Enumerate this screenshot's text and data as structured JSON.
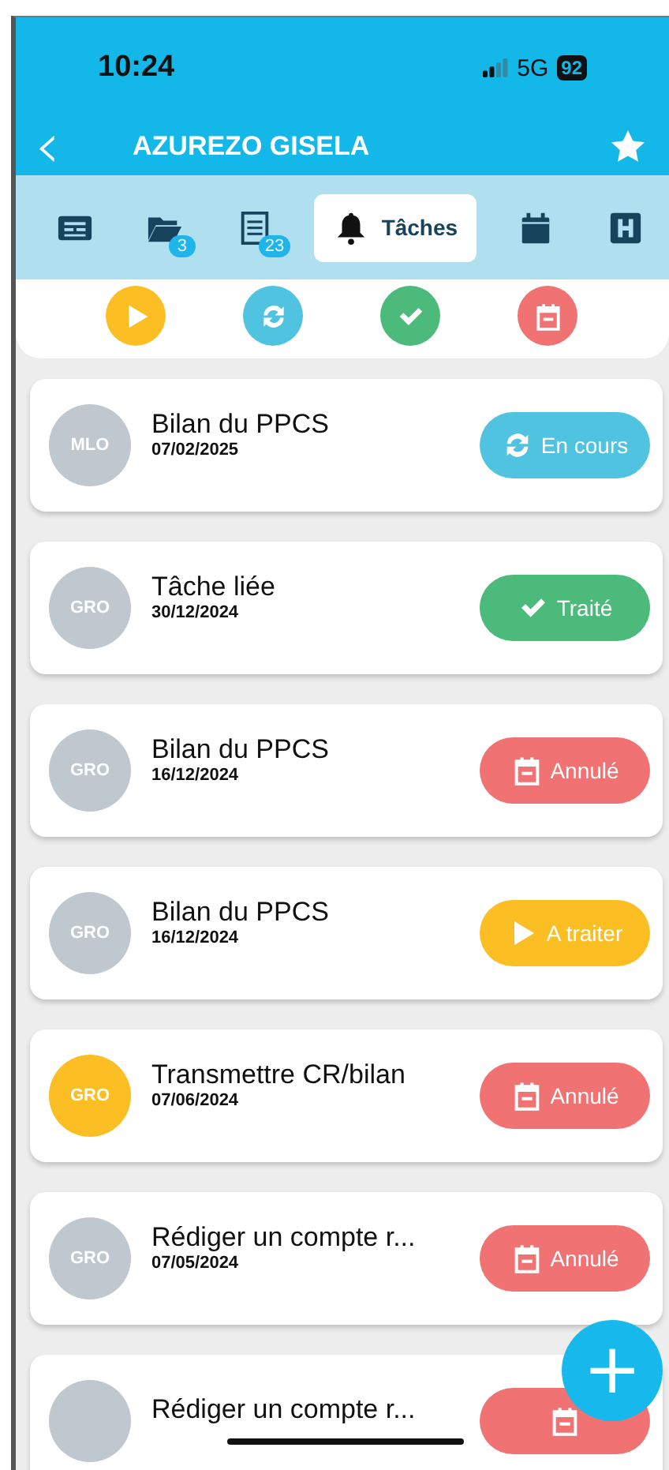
{
  "status_bar": {
    "time": "10:24",
    "network": "5G",
    "battery": "92"
  },
  "header": {
    "back": "‹",
    "title": "AZUREZO GISELA"
  },
  "tabs": [
    {
      "kind": "list",
      "selected": false
    },
    {
      "kind": "folder",
      "count": "3",
      "selected": false
    },
    {
      "kind": "document",
      "count": "23",
      "selected": false
    },
    {
      "kind": "bell",
      "label": "Tâches",
      "selected": true
    },
    {
      "kind": "calendar",
      "selected": false
    },
    {
      "kind": "hospital",
      "selected": false
    }
  ],
  "filters": [
    {
      "kind": "atraiter"
    },
    {
      "kind": "encours"
    },
    {
      "kind": "traite"
    },
    {
      "kind": "annule"
    }
  ],
  "tasks": [
    {
      "initials": "MLO",
      "color": "#bfc7cf",
      "title": "Bilan du PPCS",
      "date": "07/02/2025",
      "status": {
        "kind": "encours",
        "label": "En cours"
      }
    },
    {
      "initials": "GRO",
      "color": "#bfc7cf",
      "title": "Tâche liée",
      "date": "30/12/2024",
      "status": {
        "kind": "traite",
        "label": "Traité"
      }
    },
    {
      "initials": "GRO",
      "color": "#bfc7cf",
      "title": "Bilan du PPCS",
      "date": "16/12/2024",
      "status": {
        "kind": "annule",
        "label": "Annulé"
      }
    },
    {
      "initials": "GRO",
      "color": "#bfc7cf",
      "title": "Bilan du PPCS",
      "date": "16/12/2024",
      "status": {
        "kind": "atraiter",
        "label": "A traiter"
      }
    },
    {
      "initials": "GRO",
      "color": "#fbbf24",
      "title": "Transmettre CR/bilan",
      "date": "07/06/2024",
      "status": {
        "kind": "annule",
        "label": "Annulé"
      }
    },
    {
      "initials": "GRO",
      "color": "#bfc7cf",
      "title": "Rédiger un compte r...",
      "date": "07/05/2024",
      "status": {
        "kind": "annule",
        "label": "Annulé"
      }
    },
    {
      "color": "#bfc7cf",
      "title": "Rédiger un compte r...",
      "status": {
        "kind": "annule"
      }
    }
  ],
  "fab": "+"
}
